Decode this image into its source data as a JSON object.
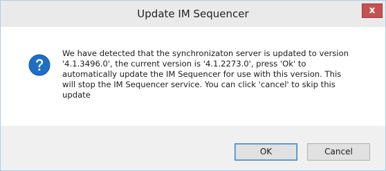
{
  "dialog": {
    "title": "Update IM Sequencer",
    "close_label": "x",
    "icon": "question-icon",
    "message": "We have detected that the synchronizaton server is updated to version\n'4.1.3496.0', the current version is '4.1.2273.0', press 'Ok' to\nautomatically update the IM Sequencer for use with this version. This\nwill stop the IM Sequencer service. You can click 'cancel' to skip this\nupdate",
    "buttons": {
      "ok_label": "OK",
      "cancel_label": "Cancel"
    }
  },
  "colors": {
    "titlebar": "#eaeaea",
    "close_button": "#c75050",
    "icon_blue": "#1c6fc4",
    "footer": "#f0f0f0"
  }
}
